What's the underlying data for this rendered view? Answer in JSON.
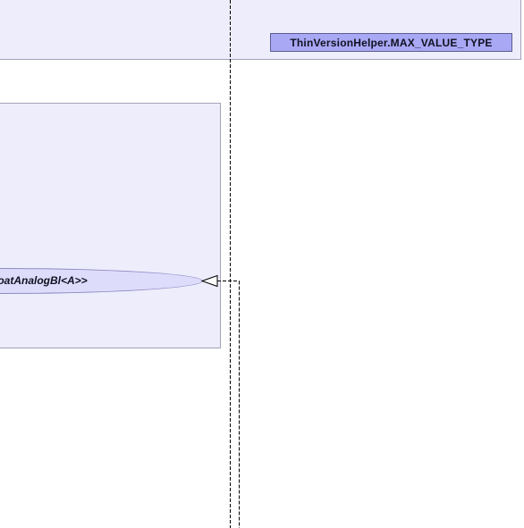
{
  "diagram": {
    "class_label": "ThinVersionHelper.MAX_VALUE_TYPE",
    "ellipse_label": "loatAnalogBl<A>>"
  },
  "colors": {
    "frame_fill": "#eeedfc",
    "frame_border": "#a3a3b8",
    "class_label_fill": "#a8a8f4",
    "ellipse_fill": "#dedcfb",
    "connector": "#000000"
  }
}
